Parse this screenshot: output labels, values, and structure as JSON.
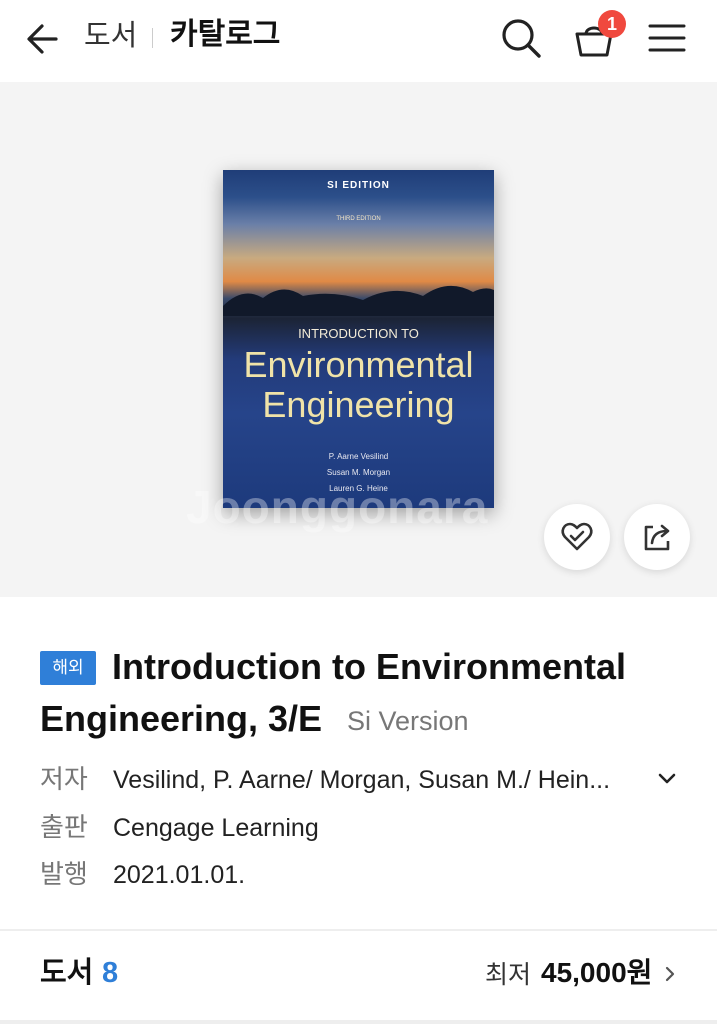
{
  "header": {
    "crumb_category": "도서",
    "crumb_current": "카탈로그",
    "cart_count": "1"
  },
  "cover": {
    "edition": "SI EDITION",
    "third": "THIRD EDITION",
    "intro": "INTRODUCTION TO",
    "title_line1": "Environmental",
    "title_line2": "Engineering",
    "authors": [
      "P. Aarne Vesilind",
      "Susan M. Morgan",
      "Lauren G. Heine"
    ],
    "watermark": "Joonggonara"
  },
  "product": {
    "tag": "해외",
    "title_line1": "Introduction to Environmental",
    "title_line2": "Engineering, 3/E",
    "subtitle": "Si Version",
    "author_label": "저자",
    "author_value": "Vesilind, P. Aarne/ Morgan, Susan M./ Hein...",
    "publisher_label": "출판",
    "publisher_value": "Cengage Learning",
    "date_label": "발행",
    "date_value": "2021.01.01."
  },
  "listing": {
    "label": "도서",
    "count": "8",
    "price_label": "최저",
    "price_value": "45,000원"
  },
  "colors": {
    "accent": "#2f7fd8",
    "badge": "#f0493e"
  }
}
